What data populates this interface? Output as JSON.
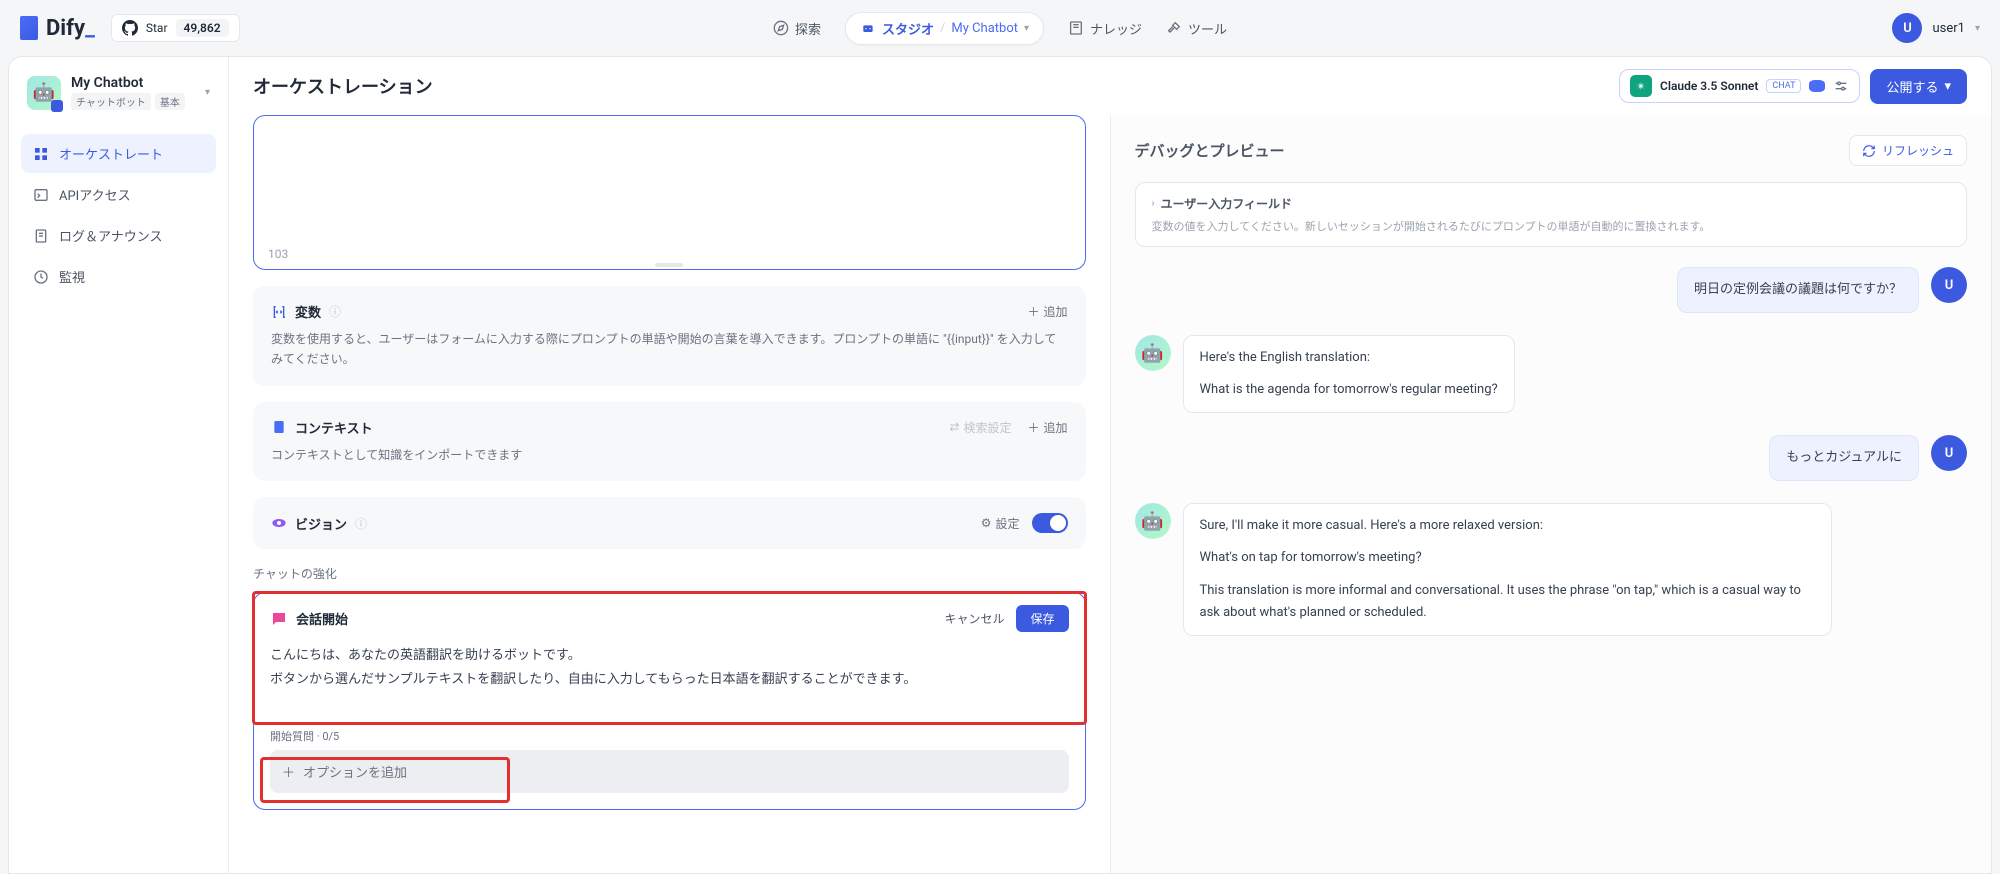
{
  "brand": "Dify",
  "github": {
    "star_label": "Star",
    "count": "49,862"
  },
  "nav": {
    "explore": "探索",
    "studio": "スタジオ",
    "current_app": "My Chatbot",
    "knowledge": "ナレッジ",
    "tools": "ツール"
  },
  "user": {
    "initial": "U",
    "name": "user1"
  },
  "sidebar": {
    "app_name": "My Chatbot",
    "tag1": "チャットボット",
    "tag2": "基本",
    "items": [
      {
        "label": "オーケストレート"
      },
      {
        "label": "APIアクセス"
      },
      {
        "label": "ログ＆アナウンス"
      },
      {
        "label": "監視"
      }
    ]
  },
  "header": {
    "title": "オーケストレーション",
    "model": "Claude 3.5 Sonnet",
    "chat_badge": "CHAT",
    "publish": "公開する"
  },
  "prompt": {
    "count": "103"
  },
  "variables": {
    "title": "変数",
    "add": "追加",
    "desc": "変数を使用すると、ユーザーはフォームに入力する際にプロンプトの単語や開始の言葉を導入できます。プロンプトの単語に \"{{input}}\" を入力してみてください。"
  },
  "context": {
    "title": "コンテキスト",
    "search": "検索設定",
    "add": "追加",
    "desc": "コンテキストとして知識をインポートできます"
  },
  "vision": {
    "title": "ビジョン",
    "settings": "設定"
  },
  "enhance_label": "チャットの強化",
  "conv_start": {
    "title": "会話開始",
    "cancel": "キャンセル",
    "save": "保存",
    "text": "こんにちは、あなたの英語翻訳を助けるボットです。\nボタンから選んだサンプルテキストを翻訳したり、自由に入力してもらった日本語を翻訳することができます。",
    "q_label": "開始質問 · 0/5",
    "add_option": "オプションを追加"
  },
  "preview": {
    "title": "デバッグとプレビュー",
    "refresh": "リフレッシュ",
    "uf_title": "ユーザー入力フィールド",
    "uf_desc": "変数の値を入力してください。新しいセッションが開始されるたびにプロンプトの単語が自動的に置換されます。"
  },
  "chat": {
    "u1": "明日の定例会議の議題は何ですか？",
    "b1_l1": "Here's the English translation:",
    "b1_l2": "What is the agenda for tomorrow's regular meeting?",
    "u2": "もっとカジュアルに",
    "b2_l1": "Sure, I'll make it more casual. Here's a more relaxed version:",
    "b2_l2": "What's on tap for tomorrow's meeting?",
    "b2_l3": "This translation is more informal and conversational. It uses the phrase \"on tap,\" which is a casual way to ask about what's planned or scheduled."
  }
}
